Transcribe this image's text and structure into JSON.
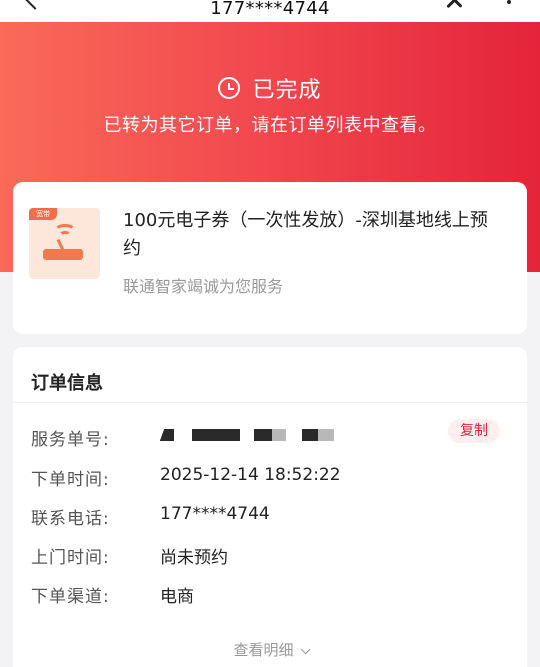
{
  "nav": {
    "title": "177****4744"
  },
  "status": {
    "title": "已完成",
    "subtitle": "已转为其它订单，请在订单列表中查看。"
  },
  "product": {
    "thumb_tag": "宽带",
    "title": "100元电子券（一次性发放）-深圳基地线上预约",
    "subtitle": "联通智家竭诚为您服务"
  },
  "order_info": {
    "title": "订单信息",
    "rows": [
      {
        "label": "服务单号:",
        "value": ""
      },
      {
        "label": "下单时间:",
        "value": "2025-12-14 18:52:22"
      },
      {
        "label": "联系电话:",
        "value": "177****4744"
      },
      {
        "label": "上门时间:",
        "value": "尚未预约"
      },
      {
        "label": "下单渠道:",
        "value": "电商"
      }
    ],
    "copy_label": "复制",
    "more_label": "查看明细"
  },
  "colors": {
    "header_start": "#f96a58",
    "header_end": "#e4243a",
    "accent": "#e62339"
  }
}
